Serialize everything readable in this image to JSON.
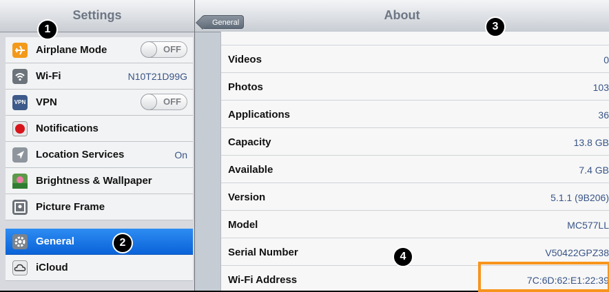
{
  "sidebar": {
    "title": "Settings",
    "items": [
      {
        "label": "Airplane Mode",
        "icon": "airplane-icon",
        "toggle": "OFF"
      },
      {
        "label": "Wi-Fi",
        "icon": "wifi-icon",
        "value": "N10T21D99G"
      },
      {
        "label": "VPN",
        "icon": "vpn-icon",
        "icon_text": "VPN",
        "toggle": "OFF"
      },
      {
        "label": "Notifications",
        "icon": "notifications-icon"
      },
      {
        "label": "Location Services",
        "icon": "location-icon",
        "value": "On"
      },
      {
        "label": "Brightness & Wallpaper",
        "icon": "wallpaper-icon"
      },
      {
        "label": "Picture Frame",
        "icon": "picture-frame-icon"
      },
      {
        "label": "General",
        "icon": "gear-icon",
        "selected": true
      },
      {
        "label": "iCloud",
        "icon": "cloud-icon"
      }
    ]
  },
  "main": {
    "title": "About",
    "back_label": "General",
    "rows": [
      {
        "key": "Videos",
        "value": "0"
      },
      {
        "key": "Photos",
        "value": "103"
      },
      {
        "key": "Applications",
        "value": "36"
      },
      {
        "key": "Capacity",
        "value": "13.8 GB"
      },
      {
        "key": "Available",
        "value": "7.4 GB"
      },
      {
        "key": "Version",
        "value": "5.1.1 (9B206)"
      },
      {
        "key": "Model",
        "value": "MC577LL"
      },
      {
        "key": "Serial Number",
        "value": "V50422GPZ38"
      },
      {
        "key": "Wi-Fi Address",
        "value": "7C:6D:62:E1:22:39"
      }
    ]
  },
  "callouts": [
    "1",
    "2",
    "3",
    "4"
  ],
  "colors": {
    "selection": "#0b63d8",
    "highlight": "#f7941d",
    "value_text": "#385487"
  }
}
